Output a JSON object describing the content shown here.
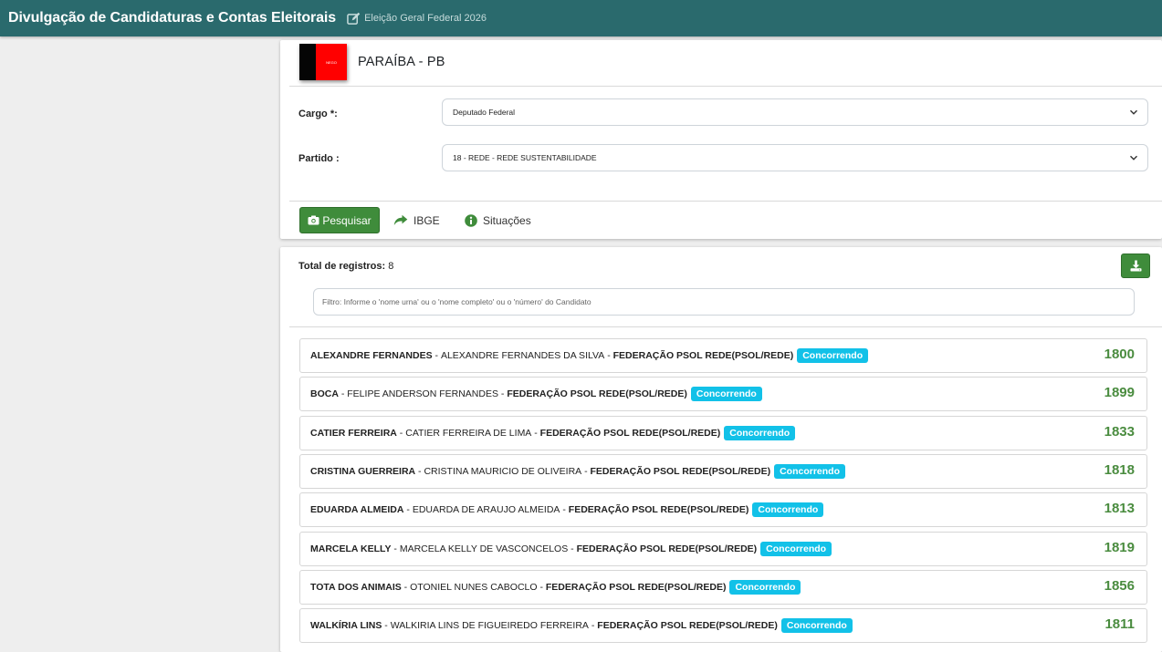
{
  "header": {
    "title": "Divulgação de Candidaturas e Contas Eleitorais",
    "election": "Eleição Geral Federal 2026"
  },
  "state": {
    "name": "PARAÍBA - PB",
    "flag_text": "NEGO"
  },
  "form": {
    "cargo_label": "Cargo *:",
    "cargo_value": "Deputado Federal",
    "partido_label": "Partido :",
    "partido_value": "18 - REDE - REDE SUSTENTABILIDADE"
  },
  "actions": {
    "search": "Pesquisar",
    "ibge": "IBGE",
    "situacoes": "Situações"
  },
  "results": {
    "total_label": "Total de registros:",
    "total_value": "8",
    "filter_placeholder": "Filtro: Informe o 'nome urna' ou o 'nome completo' ou o 'número' do Candidato",
    "rows": [
      {
        "nome_urna": "ALEXANDRE FERNANDES",
        "nome_completo": "ALEXANDRE FERNANDES DA SILVA",
        "federacao": "FEDERAÇÃO PSOL REDE(PSOL/REDE)",
        "situacao": "Concorrendo",
        "numero": "1800"
      },
      {
        "nome_urna": "BOCA",
        "nome_completo": "FELIPE ANDERSON FERNANDES",
        "federacao": "FEDERAÇÃO PSOL REDE(PSOL/REDE)",
        "situacao": "Concorrendo",
        "numero": "1899"
      },
      {
        "nome_urna": "CATIER FERREIRA",
        "nome_completo": "CATIER FERREIRA DE LIMA",
        "federacao": "FEDERAÇÃO PSOL REDE(PSOL/REDE)",
        "situacao": "Concorrendo",
        "numero": "1833"
      },
      {
        "nome_urna": "CRISTINA GUERREIRA",
        "nome_completo": "CRISTINA MAURICIO DE OLIVEIRA",
        "federacao": "FEDERAÇÃO PSOL REDE(PSOL/REDE)",
        "situacao": "Concorrendo",
        "numero": "1818"
      },
      {
        "nome_urna": "EDUARDA ALMEIDA",
        "nome_completo": "EDUARDA DE ARAUJO ALMEIDA",
        "federacao": "FEDERAÇÃO PSOL REDE(PSOL/REDE)",
        "situacao": "Concorrendo",
        "numero": "1813"
      },
      {
        "nome_urna": "MARCELA KELLY",
        "nome_completo": "MARCELA KELLY DE VASCONCELOS",
        "federacao": "FEDERAÇÃO PSOL REDE(PSOL/REDE)",
        "situacao": "Concorrendo",
        "numero": "1819"
      },
      {
        "nome_urna": "TOTA DOS ANIMAIS",
        "nome_completo": "OTONIEL NUNES CABOCLO",
        "federacao": "FEDERAÇÃO PSOL REDE(PSOL/REDE)",
        "situacao": "Concorrendo",
        "numero": "1856"
      },
      {
        "nome_urna": "WALKÍRIA LINS",
        "nome_completo": "WALKIRIA LINS DE FIGUEIREDO FERREIRA",
        "federacao": "FEDERAÇÃO PSOL REDE(PSOL/REDE)",
        "situacao": "Concorrendo",
        "numero": "1811"
      }
    ]
  }
}
